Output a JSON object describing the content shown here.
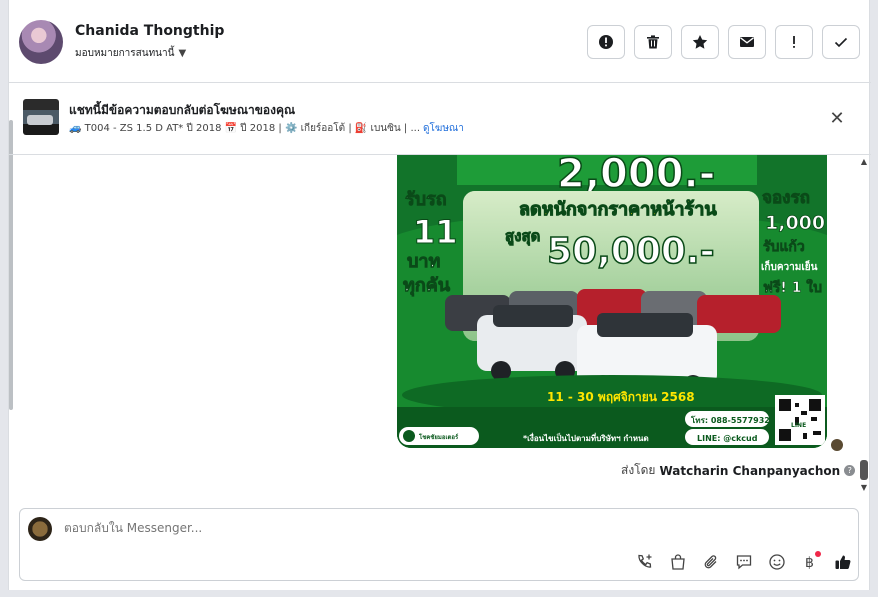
{
  "contact": {
    "name": "Chanida Thongthip",
    "assign_label": "มอบหมายการสนทนานี้"
  },
  "header_actions": [
    {
      "icon": "alert-circle-icon",
      "label": "Mark as spam"
    },
    {
      "icon": "trash-icon",
      "label": "Delete"
    },
    {
      "icon": "star-icon",
      "label": "Follow up"
    },
    {
      "icon": "envelope-icon",
      "label": "Mark as unread"
    },
    {
      "icon": "exclamation-icon",
      "label": "Mark as important"
    },
    {
      "icon": "check-icon",
      "label": "Mark as done"
    }
  ],
  "ad_banner": {
    "title": "แชทนี้มีข้อความตอบกลับต่อโฆษณาของคุณ",
    "details": "🚙 T004 - ZS 1.5 D AT* ปี 2018 📅 ปี 2018 | ⚙️ เกียร์ออโต้ | ⛽ เบนซิน | ...",
    "link_label": "ดูโฆษณา"
  },
  "ad_image": {
    "top_price": "2,000.-",
    "left_line1": "รับรถ",
    "left_line2": "11",
    "left_line3": "บาท",
    "left_line4": "ทุกคัน",
    "center_banner": "ลดหนักจากราคาหน้าร้าน",
    "max_label": "สูงสุด",
    "max_value": "50,000.-",
    "right_line1": "จองรถ",
    "right_line2": "1,000",
    "right_line3": "รับแก้ว",
    "right_line4": "เก็บความเย็น",
    "right_line5": "ฟรี! 1 ใบ",
    "date_range": "11 - 30 พฤศจิกายน 2568",
    "phone": "โทร: 088-5577932",
    "line_id": "LINE: @ckcud",
    "condition": "*เงื่อนไขเป็นไปตามที่บริษัทฯ กำหนด",
    "qr_label": "LINE"
  },
  "sent_by": {
    "prefix": "ส่งโดย",
    "name": "Watcharin Chanpanyachon"
  },
  "composer": {
    "placeholder": "ตอบกลับใน Messenger..."
  },
  "composer_tools": [
    "phone-plus-icon",
    "shopping-bag-icon",
    "paperclip-icon",
    "chat-bubble-icon",
    "smiley-icon",
    "baht-icon",
    "thumbs-up-icon"
  ],
  "colors": {
    "ad_green": "#1a8a32",
    "ad_yellow": "#ffe600",
    "link_blue": "#216fdb",
    "like_blue": "#1c1e21"
  }
}
